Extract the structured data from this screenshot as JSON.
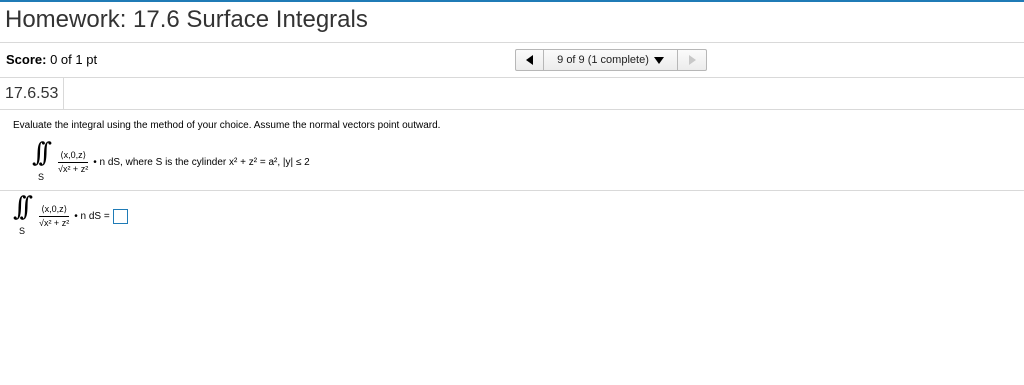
{
  "header": {
    "title": "Homework: 17.6 Surface Integrals"
  },
  "score": {
    "label": "Score:",
    "value": "0 of 1 pt"
  },
  "navigation": {
    "question_select_label": "9 of 9 (1 complete)"
  },
  "problem": {
    "id": "17.6.53",
    "instructions": "Evaluate the integral using the method of your choice. Assume the normal vectors point outward.",
    "integral_subscript": "S",
    "numerator": "⟨x,0,z⟩",
    "denominator": "√x² + z²",
    "statement_rest": "• n dS, where S is the cylinder x² + z² = a², |y| ≤ 2",
    "answer_rest": "• n dS ="
  },
  "colors": {
    "accent": "#1f7bb6",
    "divider": "#d9d9d9"
  }
}
